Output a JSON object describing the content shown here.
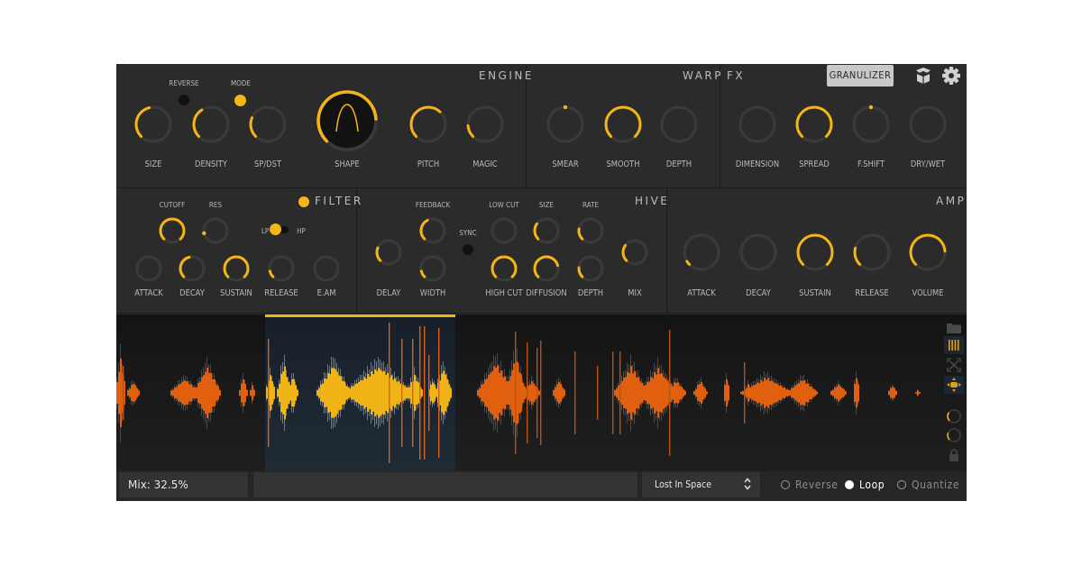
{
  "colors": {
    "accent": "#f5b516",
    "track": "#3a3a3a",
    "panel": "#2b2b2b",
    "wave_orange": "#e0600f",
    "wave_selected": "#f0b416"
  },
  "header": {
    "engine_title": "ENGINE",
    "warp_title": "WARP",
    "fx_title": "FX",
    "mode_button": "GRANULIZER",
    "icons": [
      "box-icon",
      "gear-icon"
    ]
  },
  "engine": {
    "reverse_label": "REVERSE",
    "reverse_on": false,
    "mode_label": "MODE",
    "mode_on": true,
    "knobs": [
      {
        "label": "SIZE",
        "value": 0.45
      },
      {
        "label": "DENSITY",
        "value": 0.38
      },
      {
        "label": "SP/DST",
        "value": 0.25
      },
      {
        "label": "SHAPE",
        "value": 0.82
      },
      {
        "label": "PITCH",
        "value": 0.66
      },
      {
        "label": "MAGIC",
        "value": 0.15
      }
    ]
  },
  "warp": {
    "knobs": [
      {
        "label": "SMEAR",
        "value": 0.5,
        "dot": true
      },
      {
        "label": "SMOOTH",
        "value": 1.0
      },
      {
        "label": "DEPTH",
        "value": 0.0
      }
    ]
  },
  "fx": {
    "knobs": [
      {
        "label": "DIMENSION",
        "value": 0.0
      },
      {
        "label": "SPREAD",
        "value": 1.0
      },
      {
        "label": "F.SHIFT",
        "value": 0.5,
        "dot": true
      },
      {
        "label": "DRY/WET",
        "value": 0.0
      }
    ]
  },
  "filter": {
    "title": "FILTER",
    "enabled": true,
    "cutoff": {
      "label": "CUTOFF",
      "value": 1.0
    },
    "res": {
      "label": "RES",
      "value": 0.0,
      "dot": true
    },
    "lp_label": "LP",
    "hp_label": "HP",
    "mode": "LP",
    "env": [
      {
        "label": "ATTACK",
        "value": 0.0
      },
      {
        "label": "DECAY",
        "value": 0.45
      },
      {
        "label": "SUSTAIN",
        "value": 1.0
      },
      {
        "label": "RELEASE",
        "value": 0.12
      },
      {
        "label": "E.AM",
        "value": 0.0
      }
    ]
  },
  "hive": {
    "title": "HIVE",
    "sync_label": "SYNC",
    "sync_on": false,
    "knobs": [
      {
        "label": "DELAY",
        "value": 0.25
      },
      {
        "label": "FEEDBACK",
        "value": 0.4
      },
      {
        "label": "WIDTH",
        "value": 0.12
      },
      {
        "label": "LOW CUT",
        "value": 0.0
      },
      {
        "label": "HIGH CUT",
        "value": 1.0
      },
      {
        "label": "SIZE",
        "value": 0.3
      },
      {
        "label": "DIFFUSION",
        "value": 0.78
      },
      {
        "label": "RATE",
        "value": 0.2
      },
      {
        "label": "DEPTH",
        "value": 0.18
      },
      {
        "label": "MIX",
        "value": 0.3
      }
    ]
  },
  "amp": {
    "title": "AMP",
    "knobs": [
      {
        "label": "ATTACK",
        "value": 0.05
      },
      {
        "label": "DECAY",
        "value": 0.0
      },
      {
        "label": "SUSTAIN",
        "value": 1.0
      },
      {
        "label": "RELEASE",
        "value": 0.22
      },
      {
        "label": "VOLUME",
        "value": 0.82
      }
    ]
  },
  "waveform": {
    "selection_start": 0.175,
    "selection_end": 0.399,
    "side_icons": [
      "folder-icon",
      "grid-bars-icon",
      "expand-icon",
      "move-icon",
      "knob-small-1",
      "knob-small-2",
      "lock-icon"
    ],
    "side_knobs": [
      0.3,
      0.25
    ]
  },
  "bottom": {
    "mix_text": "Mix: 32.5%",
    "preset": "Lost In Space",
    "options": [
      {
        "label": "Reverse",
        "selected": false
      },
      {
        "label": "Loop",
        "selected": true
      },
      {
        "label": "Quantize",
        "selected": false
      }
    ]
  }
}
